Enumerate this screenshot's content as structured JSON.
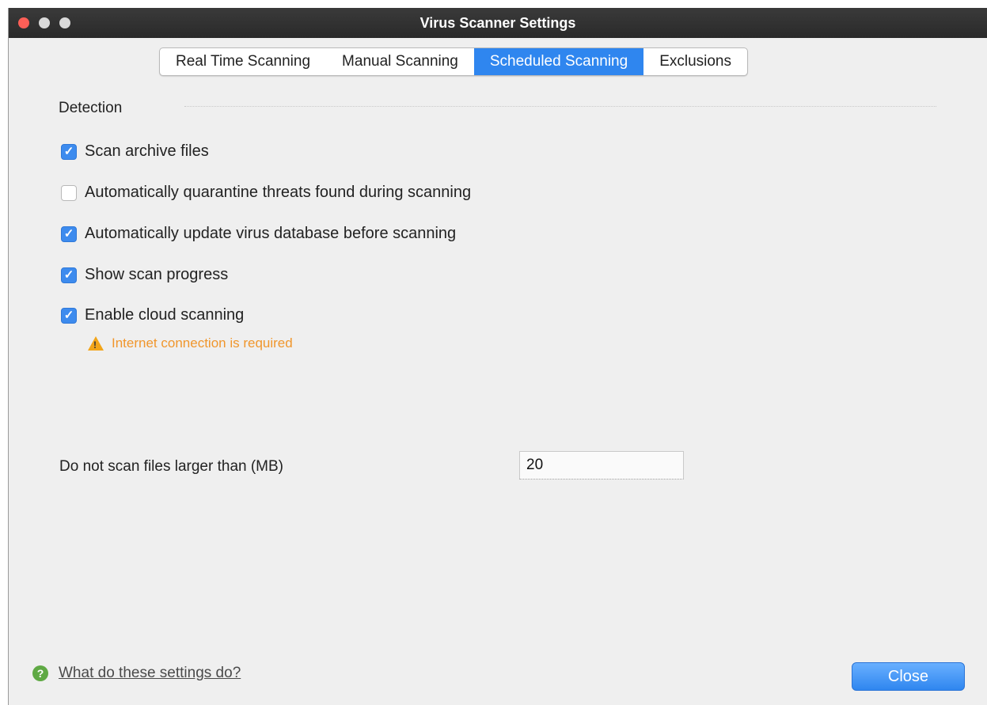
{
  "window": {
    "title": "Virus Scanner Settings"
  },
  "tabs": [
    {
      "label": "Real Time Scanning",
      "active": false
    },
    {
      "label": "Manual Scanning",
      "active": false
    },
    {
      "label": "Scheduled Scanning",
      "active": true
    },
    {
      "label": "Exclusions",
      "active": false
    }
  ],
  "detection": {
    "heading": "Detection",
    "options": [
      {
        "label": "Scan archive files",
        "checked": true
      },
      {
        "label": "Automatically quarantine threats found during scanning",
        "checked": false
      },
      {
        "label": "Automatically update virus database before scanning",
        "checked": true
      },
      {
        "label": "Show scan progress",
        "checked": true
      },
      {
        "label": "Enable cloud scanning",
        "checked": true
      }
    ],
    "warning": "Internet connection is required"
  },
  "file_size": {
    "label": "Do not scan files larger than (MB)",
    "value": "20"
  },
  "footer": {
    "help_link": "What do these settings do?",
    "close_label": "Close"
  },
  "colors": {
    "accent": "#2f86ef",
    "warning": "#f0962c",
    "help_icon": "#5fa944"
  }
}
